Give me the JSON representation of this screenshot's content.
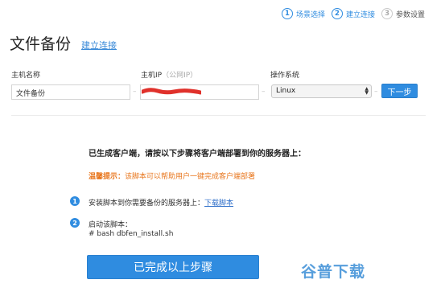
{
  "stepper": {
    "steps": [
      {
        "num": "1",
        "label": "场景选择"
      },
      {
        "num": "2",
        "label": "建立连接"
      },
      {
        "num": "3",
        "label": "参数设置"
      }
    ]
  },
  "header": {
    "title": "文件备份",
    "link": "建立连接"
  },
  "form": {
    "host_name_label": "主机名称",
    "host_name_value": "文件备份",
    "host_ip_label": "主机IP",
    "host_ip_hint": "（公网IP）",
    "dash": "–",
    "os_label": "操作系统",
    "os_value": "Linux",
    "next_button": "下一步"
  },
  "instructions": {
    "heading": "已生成客户端，请按以下步骤将客户端部署到你的服务器上：",
    "warn_title": "温馨提示：",
    "warn_text": "该脚本可以帮助用户一键完成客户端部署",
    "step1_num": "1",
    "step1_text": "安装脚本到你需要备份的服务器上：",
    "step1_link": "下载脚本",
    "step2_num": "2",
    "step2_text": "启动该脚本：",
    "step2_command": "# bash dbfen_install.sh"
  },
  "done_button": "已完成以上步骤",
  "watermark": "谷普下载",
  "colors": {
    "accent": "#2f8ce0",
    "warning": "#e8761d",
    "redaction": "#e0312b"
  }
}
